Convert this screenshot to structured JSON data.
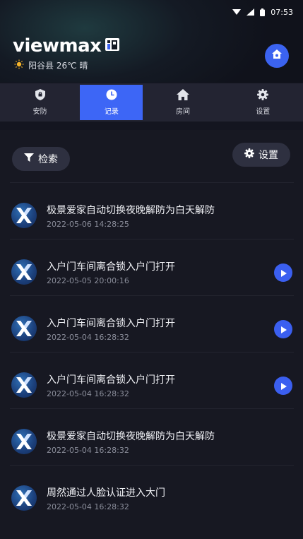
{
  "status_bar": {
    "time": "07:53"
  },
  "brand": {
    "logo_text": "viewmax"
  },
  "weather": {
    "text": "阳谷县 26℃ 晴"
  },
  "tabs": [
    {
      "label": "安防",
      "icon": "shield-icon",
      "active": false
    },
    {
      "label": "记录",
      "icon": "clock-icon",
      "active": true
    },
    {
      "label": "房间",
      "icon": "house-icon",
      "active": false
    },
    {
      "label": "设置",
      "icon": "gear-icon",
      "active": false
    }
  ],
  "toolbar": {
    "search_label": "检索",
    "settings_label": "设置"
  },
  "records": [
    {
      "title": "极景爱家自动切换夜晚解防为白天解防",
      "time": "2022-05-06 14:28:25",
      "has_play": false
    },
    {
      "title": "入户门车间离合锁入户门打开",
      "time": "2022-05-05 20:00:16",
      "has_play": true
    },
    {
      "title": "入户门车间离合锁入户门打开",
      "time": "2022-05-04 16:28:32",
      "has_play": true
    },
    {
      "title": "入户门车间离合锁入户门打开",
      "time": "2022-05-04 16:28:32",
      "has_play": true
    },
    {
      "title": "极景爱家自动切换夜晚解防为白天解防",
      "time": "2022-05-04 16:28:32",
      "has_play": false
    },
    {
      "title": "周然通过人脸认证进入大门",
      "time": "2022-05-04 16:28:32",
      "has_play": false
    }
  ],
  "colors": {
    "accent": "#3d66f6",
    "background": "#171822",
    "tabbar": "#232432"
  }
}
